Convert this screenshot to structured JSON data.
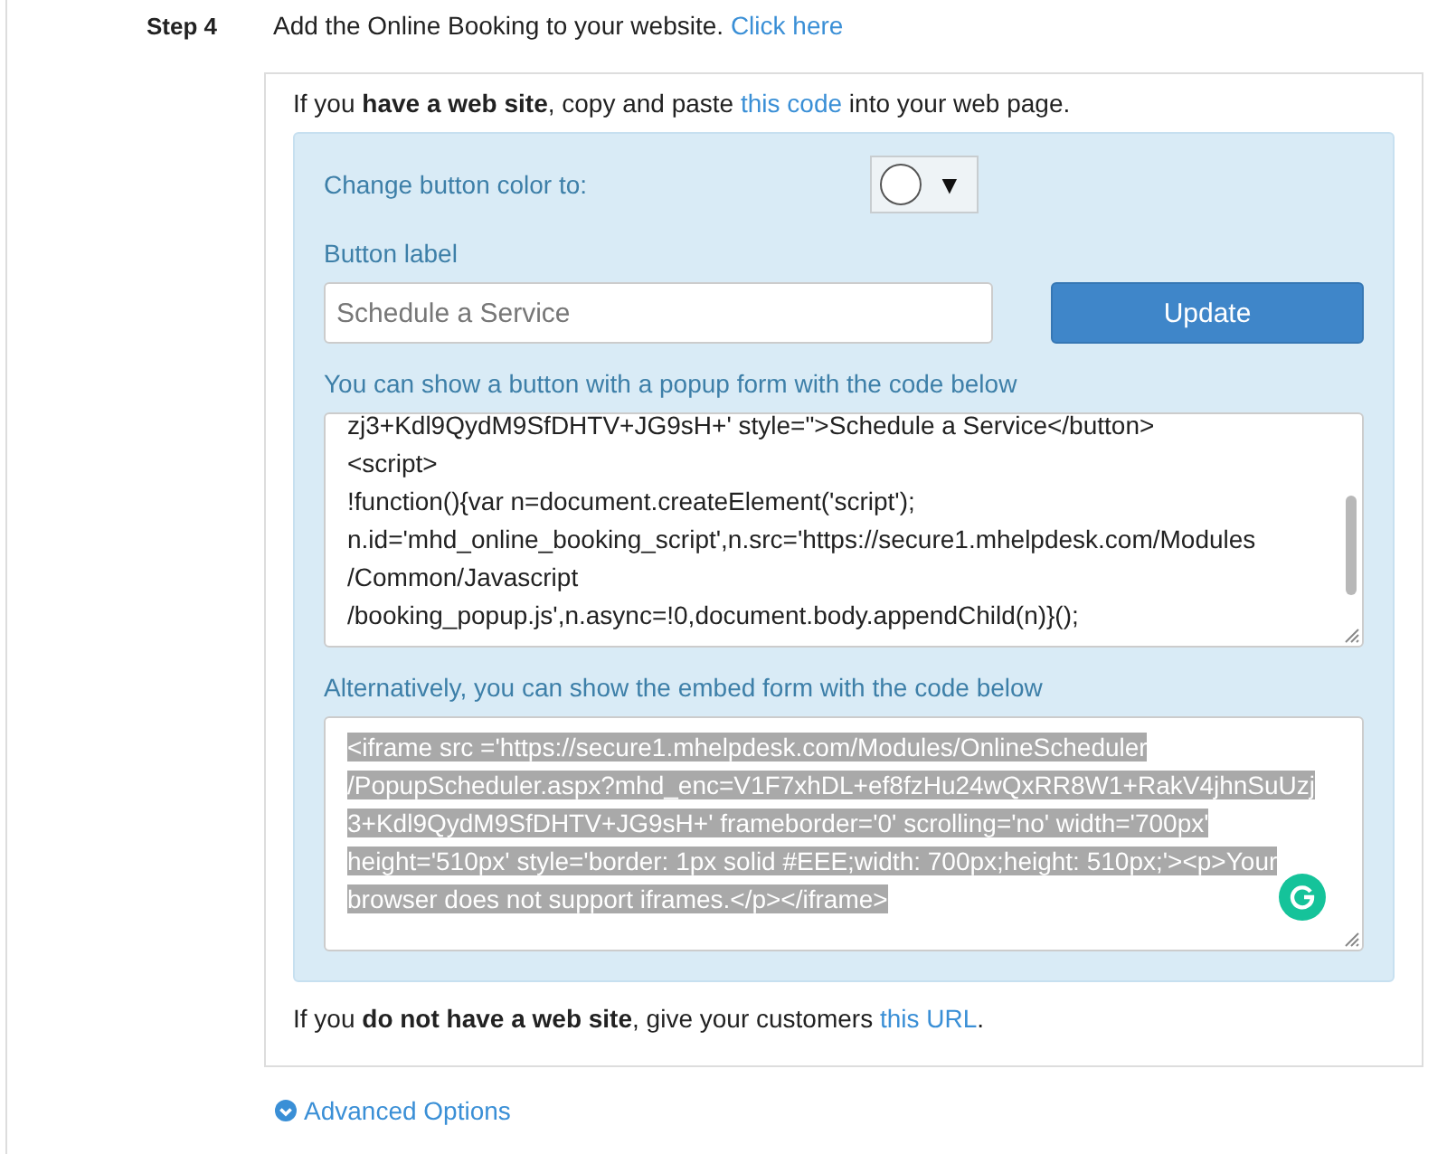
{
  "step": {
    "label": "Step 4",
    "text": "Add the Online Booking to your website.",
    "link": "Click here"
  },
  "intro": {
    "before": "If you **have a web site**, copy and paste",
    "link": "this code",
    "after": "into your web page."
  },
  "color_picker": {
    "label": "Change button color to:",
    "color": "#ffffff",
    "caret": "▼"
  },
  "button_label": {
    "label": "Button label",
    "placeholder": "Schedule a Service",
    "button": "Update"
  },
  "popup_code": {
    "label": "You can show a button with a popup form with the code below",
    "lines": [
      "zj3+Kdl9QydM9SfDHTV+JG9sH+' style=\">Schedule a Service</button>",
      "<script>",
      "!function(){var n=document.createElement('script');",
      "n.id='mhd_online_booking_script',n.src='https://secure1.mhelpdesk.com/Modules",
      "/Common/Javascript",
      "/booking_popup.js',n.async=!0,document.body.appendChild(n)}();"
    ]
  },
  "embed_code": {
    "label": "Alternatively, you can show the embed form with the code below",
    "selected": true,
    "lines": [
      "<iframe src ='https://secure1.mhelpdesk.com/Modules/OnlineScheduler",
      "/PopupScheduler.aspx?mhd_enc=V1F7xhDL+ef8fzHu24wQxRR8W1+RakV4jhnSuUzj",
      "3+Kdl9QydM9SfDHTV+JG9sH+' frameborder='0' scrolling='no' width='700px'",
      "height='510px' style='border: 1px solid #EEE;width: 700px;height: 510px;'><p>Your",
      "browser does not support iframes.</p></iframe>"
    ]
  },
  "outro": {
    "before": "If you **do not have a web site**, give your customers",
    "link": "this URL",
    "after": "."
  },
  "advanced": {
    "label": "Advanced Options"
  }
}
